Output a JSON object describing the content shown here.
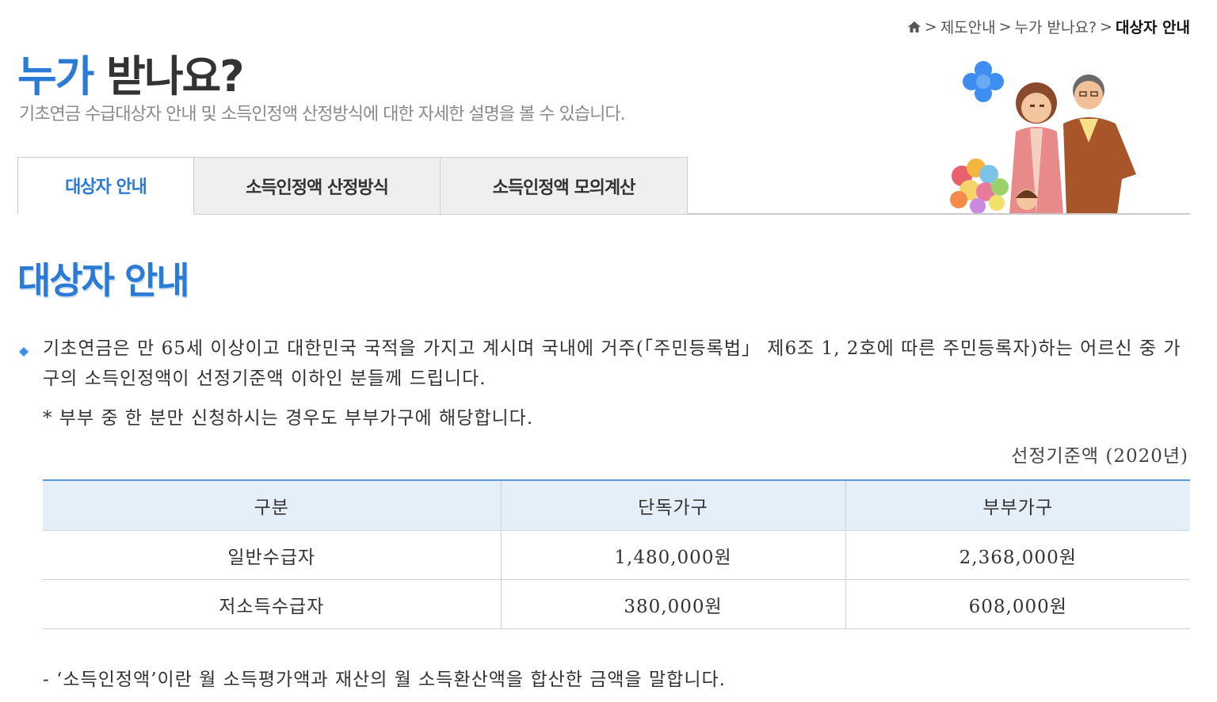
{
  "breadcrumb": {
    "home_icon": "home-icon",
    "separator": ">",
    "items": [
      "제도안내",
      "누가 받나요?"
    ],
    "current": "대상자 안내"
  },
  "hero": {
    "title_accent": "누가",
    "title_rest": " 받나요?",
    "subtitle": "기초연금 수급대상자 안내 및 소득인정액 산정방식에 대한 자세한 설명을 볼 수 있습니다."
  },
  "tabs": [
    {
      "label": "대상자 안내",
      "active": true
    },
    {
      "label": "소득인정액 산정방식",
      "active": false
    },
    {
      "label": "소득인정액 모의계산",
      "active": false
    }
  ],
  "section": {
    "title": "대상자 안내",
    "bullet_icon": "diamond-bullet-icon",
    "description": "기초연금은 만 65세 이상이고 대한민국 국적을 가지고 계시며 국내에 거주(「주민등록법」 제6조 1, 2호에 따른 주민등록자)하는 어르신 중 가구의 소득인정액이 선정기준액 이하인 분들께 드립니다.",
    "note": "* 부부 중 한 분만 신청하시는 경우도 부부가구에 해당합니다."
  },
  "table": {
    "caption": "선정기준액 (2020년)",
    "headers": [
      "구분",
      "단독가구",
      "부부가구"
    ],
    "rows": [
      [
        "일반수급자",
        "1,480,000원",
        "2,368,000원"
      ],
      [
        "저소득수급자",
        "380,000원",
        "608,000원"
      ]
    ]
  },
  "footnote": "- ‘소득인정액’이란 월 소득평가액과 재산의 월 소득환산액을 합산한 금액을 말합니다.",
  "colors": {
    "accent": "#2a7ad6",
    "header_bg": "#e5eff9",
    "tab_inactive_bg": "#efefef"
  }
}
